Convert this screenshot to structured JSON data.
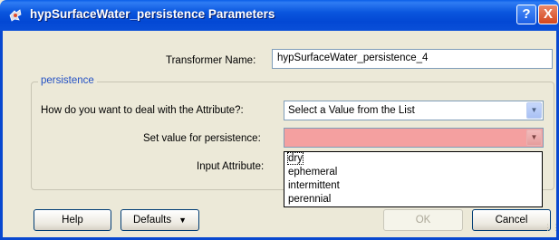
{
  "window": {
    "title": "hypSurfaceWater_persistence Parameters",
    "help_btn": "?",
    "close_btn": "X"
  },
  "transformer_name": {
    "label": "Transformer Name:",
    "value": "hypSurfaceWater_persistence_4"
  },
  "group": {
    "title": "persistence",
    "attribute_question": "How do you want to deal with the Attribute?:",
    "attribute_choice": "Select a Value from the List",
    "set_value_label": "Set value for persistence:",
    "set_value": "",
    "input_attribute_label": "Input Attribute:"
  },
  "dropdown": {
    "options": [
      "dry",
      "ephemeral",
      "intermittent",
      "perennial"
    ]
  },
  "buttons": {
    "help": "Help",
    "defaults": "Defaults",
    "ok": "OK",
    "cancel": "Cancel"
  },
  "colors": {
    "titlebar": "#0a56de",
    "invalid_field": "#f4a0a0",
    "group_title": "#2250c4"
  }
}
